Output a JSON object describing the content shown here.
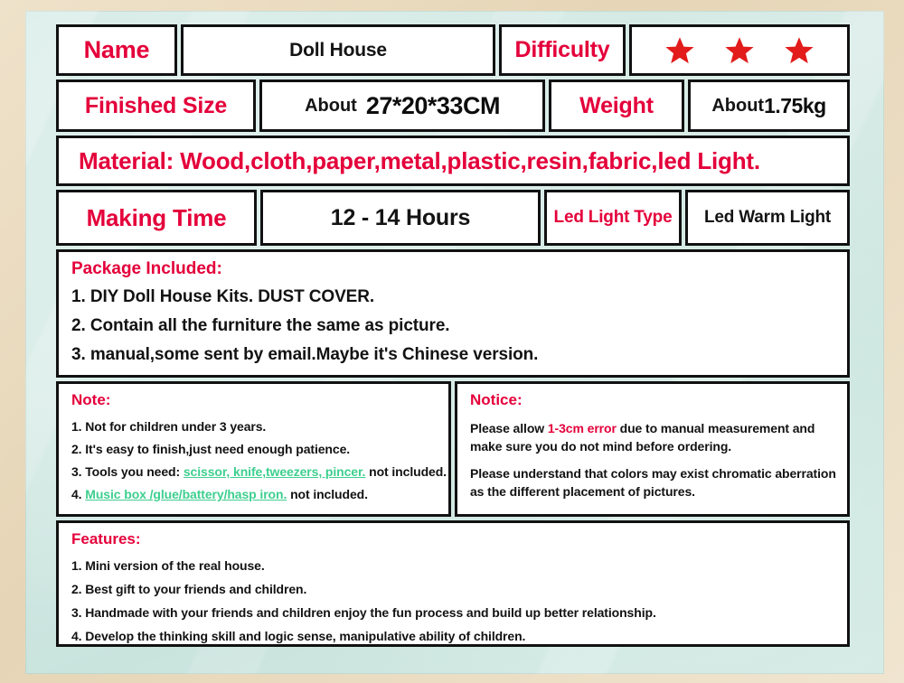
{
  "colors": {
    "label_red": "#e4003a",
    "value_black": "#141414",
    "tool_green": "#3ecf8e",
    "frame_tan": "#e8d9bc",
    "inner_mint": "#cfe7e1",
    "star_red": "#e21b1b",
    "border_black": "#111111"
  },
  "spec": {
    "name_label": "Name",
    "name_value": "Doll House",
    "difficulty_label": "Difficulty",
    "difficulty_stars": 3,
    "finished_size_label": "Finished Size",
    "finished_size_about": "About",
    "finished_size_value": "27*20*33CM",
    "weight_label": "Weight",
    "weight_about": "About",
    "weight_value": "1.75kg",
    "material_line": "Material: Wood,cloth,paper,metal,plastic,resin,fabric,led Light.",
    "making_time_label": "Making Time",
    "making_time_value": "12 - 14 Hours",
    "led_light_type_label": "Led Light Type",
    "led_light_type_value": "Led Warm Light"
  },
  "package": {
    "heading": "Package Included:",
    "items": [
      "1. DIY Doll House Kits. DUST COVER.",
      "2. Contain all the furniture the same as picture.",
      "3. manual,some sent by email.Maybe it's Chinese version."
    ]
  },
  "note": {
    "heading": "Note:",
    "item1": "1. Not for children under 3 years.",
    "item2": "2. It's easy to finish,just need enough patience.",
    "item3_pre": "3. Tools you need:",
    "item3_tools": "scissor, knife,tweezers, pincer.",
    "item3_post": "not included.",
    "item4_pre": "4.",
    "item4_tools": "Music box /glue/battery/hasp iron.",
    "item4_post": "not included."
  },
  "notice": {
    "heading": "Notice:",
    "line1_pre": "Please allow",
    "line1_err": "1-3cm error",
    "line1_post": "due to manual measurement and make sure you do not mind before ordering.",
    "line2": "Please understand that colors may exist chromatic aberration as the different placement of pictures."
  },
  "features": {
    "heading": "Features:",
    "items": [
      "1. Mini version of the real house.",
      "2. Best gift to your friends and children.",
      "3. Handmade with your friends and children enjoy the fun process and build up better relationship.",
      "4. Develop the thinking skill and logic sense, manipulative ability of children."
    ]
  }
}
